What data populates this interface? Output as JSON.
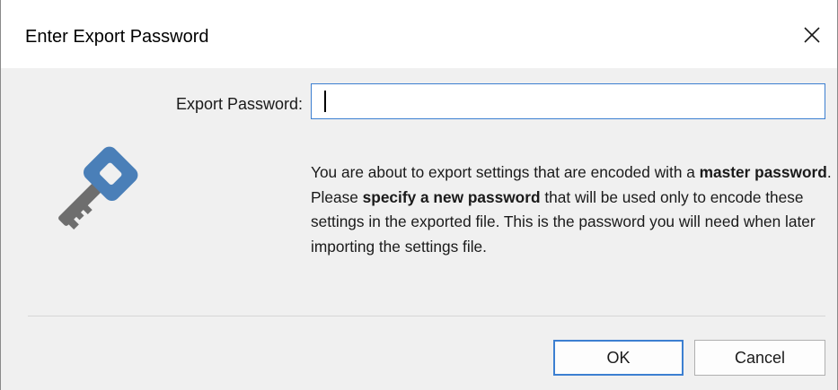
{
  "dialog": {
    "title": "Enter Export Password",
    "close_icon": "close-icon",
    "field_label": "Export Password:",
    "password_value": "",
    "key_icon": "key-icon",
    "key_color": "#4a7fb8",
    "key_blade_color": "#6e6e6e",
    "message": {
      "p1": "You are about to export settings that are encoded with a ",
      "b1": "master password",
      "p2": ". Please ",
      "b2": "specify a new password",
      "p3": " that will be used only to encode these settings in the exported file. This is the password you will need when later importing the settings file."
    },
    "ok_label": "OK",
    "cancel_label": "Cancel",
    "accent_color": "#3c7fd1"
  }
}
